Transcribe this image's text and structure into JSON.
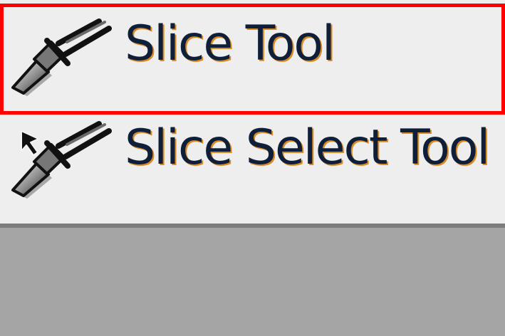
{
  "tool_menu": {
    "items": [
      {
        "label": "Slice Tool",
        "icon": "slice-icon",
        "selected": true
      },
      {
        "label": "Slice Select Tool",
        "icon": "slice-select-icon",
        "selected": false
      }
    ]
  },
  "colors": {
    "menu_background": "#eeeeee",
    "canvas_background": "#a5a5a5",
    "highlight": "#ff0000",
    "text": "#0f1f3a",
    "text_shadow": "#d98a22"
  }
}
